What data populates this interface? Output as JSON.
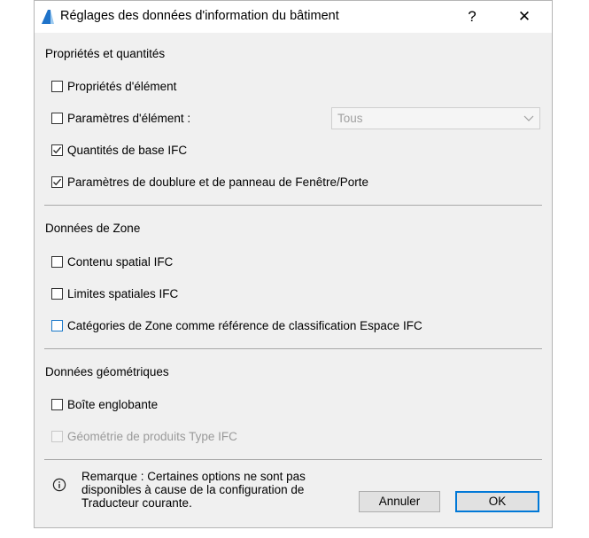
{
  "window": {
    "title": "Réglages des données d'information du bâtiment",
    "help_label": "?",
    "close_label": "✕"
  },
  "sections": {
    "properties": {
      "label": "Propriétés et quantités",
      "options": [
        {
          "label": "Propriétés d'élément",
          "checked": false
        },
        {
          "label": "Paramètres d'élément :",
          "checked": false
        },
        {
          "label": "Quantités de base IFC",
          "checked": true
        },
        {
          "label": "Paramètres de doublure et de panneau de Fenêtre/Porte",
          "checked": true
        }
      ],
      "element_params_select": {
        "value": "Tous",
        "enabled": false
      }
    },
    "zone": {
      "label": "Données de Zone",
      "options": [
        {
          "label": "Contenu spatial IFC",
          "checked": false
        },
        {
          "label": "Limites spatiales IFC",
          "checked": false
        },
        {
          "label": "Catégories de Zone comme référence de classification Espace IFC",
          "checked": false,
          "focused": true
        }
      ]
    },
    "geometry": {
      "label": "Données géométriques",
      "options": [
        {
          "label": "Boîte englobante",
          "checked": false
        },
        {
          "label": "Géométrie de produits Type IFC",
          "checked": false,
          "disabled": true
        }
      ]
    }
  },
  "note": {
    "line1": "Remarque : Certaines options ne sont pas",
    "line2": "disponibles à cause de la configuration de",
    "line3": "Traducteur courante."
  },
  "buttons": {
    "cancel_label": "Annuler",
    "ok_label": "OK"
  },
  "colors": {
    "focus_accent": "#1a78c9",
    "dialog_background": "#f0f0f0"
  }
}
